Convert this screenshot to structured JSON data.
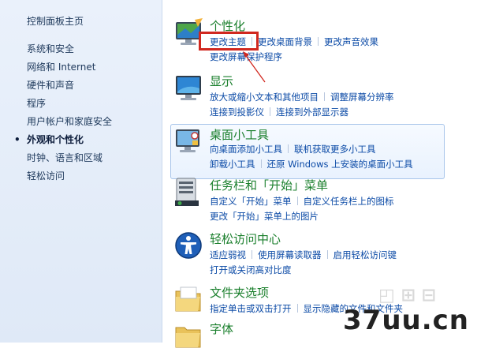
{
  "sidebar": {
    "home": "控制面板主页",
    "items": [
      "系统和安全",
      "网络和 Internet",
      "硬件和声音",
      "程序",
      "用户帐户和家庭安全",
      "外观和个性化",
      "时钟、语言和区域",
      "轻松访问"
    ],
    "active_index": 5,
    "bullet": "•"
  },
  "categories": {
    "personalize": {
      "title": "个性化",
      "links": [
        "更改主题",
        "更改桌面背景",
        "更改声音效果",
        "更改屏幕保护程序"
      ],
      "icon": "personalize-monitor-icon"
    },
    "display": {
      "title": "显示",
      "links": [
        "放大或缩小文本和其他项目",
        "调整屏幕分辨率",
        "连接到投影仪",
        "连接到外部显示器"
      ],
      "icon": "display-monitor-icon"
    },
    "gadgets": {
      "title": "桌面小工具",
      "links": [
        "向桌面添加小工具",
        "联机获取更多小工具",
        "卸载小工具",
        "还原 Windows 上安装的桌面小工具"
      ],
      "icon": "gadgets-icon"
    },
    "taskbar": {
      "title": "任务栏和「开始」菜单",
      "links": [
        "自定义「开始」菜单",
        "自定义任务栏上的图标",
        "更改「开始」菜单上的图片"
      ],
      "icon": "taskbar-icon"
    },
    "ease": {
      "title": "轻松访问中心",
      "links": [
        "适应弱视",
        "使用屏幕读取器",
        "启用轻松访问键",
        "打开或关闭高对比度"
      ],
      "icon": "ease-of-access-icon"
    },
    "folder": {
      "title": "文件夹选项",
      "links": [
        "指定单击或双击打开",
        "显示隐藏的文件和文件夹"
      ],
      "icon": "folder-icon"
    },
    "fonts": {
      "title": "字体",
      "icon": "fonts-icon"
    }
  },
  "watermark": "37uu.cn",
  "colors": {
    "title_green": "#1a7f2c",
    "link_blue": "#0b4aa6",
    "annotation_red": "#d1281f"
  }
}
